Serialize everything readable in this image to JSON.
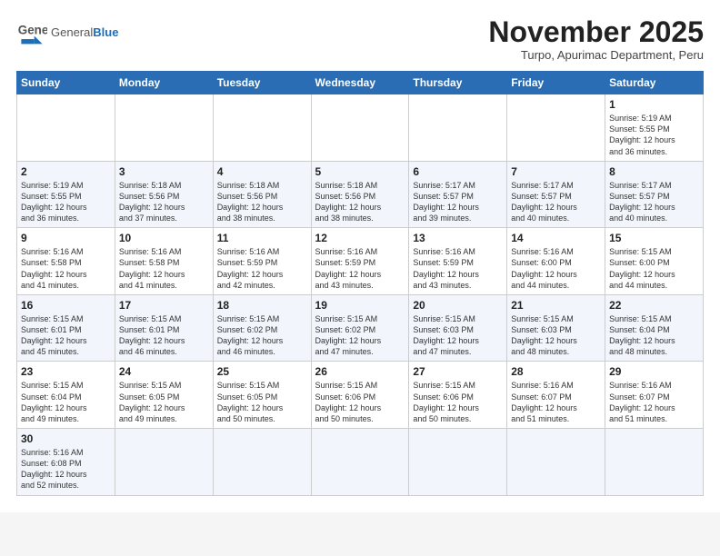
{
  "header": {
    "logo_general": "General",
    "logo_blue": "Blue",
    "month_title": "November 2025",
    "subtitle": "Turpo, Apurimac Department, Peru"
  },
  "weekdays": [
    "Sunday",
    "Monday",
    "Tuesday",
    "Wednesday",
    "Thursday",
    "Friday",
    "Saturday"
  ],
  "weeks": [
    [
      {
        "day": "",
        "info": ""
      },
      {
        "day": "",
        "info": ""
      },
      {
        "day": "",
        "info": ""
      },
      {
        "day": "",
        "info": ""
      },
      {
        "day": "",
        "info": ""
      },
      {
        "day": "",
        "info": ""
      },
      {
        "day": "1",
        "info": "Sunrise: 5:19 AM\nSunset: 5:55 PM\nDaylight: 12 hours\nand 36 minutes."
      }
    ],
    [
      {
        "day": "2",
        "info": "Sunrise: 5:19 AM\nSunset: 5:55 PM\nDaylight: 12 hours\nand 36 minutes."
      },
      {
        "day": "3",
        "info": "Sunrise: 5:18 AM\nSunset: 5:56 PM\nDaylight: 12 hours\nand 37 minutes."
      },
      {
        "day": "4",
        "info": "Sunrise: 5:18 AM\nSunset: 5:56 PM\nDaylight: 12 hours\nand 38 minutes."
      },
      {
        "day": "5",
        "info": "Sunrise: 5:18 AM\nSunset: 5:56 PM\nDaylight: 12 hours\nand 38 minutes."
      },
      {
        "day": "6",
        "info": "Sunrise: 5:17 AM\nSunset: 5:57 PM\nDaylight: 12 hours\nand 39 minutes."
      },
      {
        "day": "7",
        "info": "Sunrise: 5:17 AM\nSunset: 5:57 PM\nDaylight: 12 hours\nand 40 minutes."
      },
      {
        "day": "8",
        "info": "Sunrise: 5:17 AM\nSunset: 5:57 PM\nDaylight: 12 hours\nand 40 minutes."
      }
    ],
    [
      {
        "day": "9",
        "info": "Sunrise: 5:16 AM\nSunset: 5:58 PM\nDaylight: 12 hours\nand 41 minutes."
      },
      {
        "day": "10",
        "info": "Sunrise: 5:16 AM\nSunset: 5:58 PM\nDaylight: 12 hours\nand 41 minutes."
      },
      {
        "day": "11",
        "info": "Sunrise: 5:16 AM\nSunset: 5:59 PM\nDaylight: 12 hours\nand 42 minutes."
      },
      {
        "day": "12",
        "info": "Sunrise: 5:16 AM\nSunset: 5:59 PM\nDaylight: 12 hours\nand 43 minutes."
      },
      {
        "day": "13",
        "info": "Sunrise: 5:16 AM\nSunset: 5:59 PM\nDaylight: 12 hours\nand 43 minutes."
      },
      {
        "day": "14",
        "info": "Sunrise: 5:16 AM\nSunset: 6:00 PM\nDaylight: 12 hours\nand 44 minutes."
      },
      {
        "day": "15",
        "info": "Sunrise: 5:15 AM\nSunset: 6:00 PM\nDaylight: 12 hours\nand 44 minutes."
      }
    ],
    [
      {
        "day": "16",
        "info": "Sunrise: 5:15 AM\nSunset: 6:01 PM\nDaylight: 12 hours\nand 45 minutes."
      },
      {
        "day": "17",
        "info": "Sunrise: 5:15 AM\nSunset: 6:01 PM\nDaylight: 12 hours\nand 46 minutes."
      },
      {
        "day": "18",
        "info": "Sunrise: 5:15 AM\nSunset: 6:02 PM\nDaylight: 12 hours\nand 46 minutes."
      },
      {
        "day": "19",
        "info": "Sunrise: 5:15 AM\nSunset: 6:02 PM\nDaylight: 12 hours\nand 47 minutes."
      },
      {
        "day": "20",
        "info": "Sunrise: 5:15 AM\nSunset: 6:03 PM\nDaylight: 12 hours\nand 47 minutes."
      },
      {
        "day": "21",
        "info": "Sunrise: 5:15 AM\nSunset: 6:03 PM\nDaylight: 12 hours\nand 48 minutes."
      },
      {
        "day": "22",
        "info": "Sunrise: 5:15 AM\nSunset: 6:04 PM\nDaylight: 12 hours\nand 48 minutes."
      }
    ],
    [
      {
        "day": "23",
        "info": "Sunrise: 5:15 AM\nSunset: 6:04 PM\nDaylight: 12 hours\nand 49 minutes."
      },
      {
        "day": "24",
        "info": "Sunrise: 5:15 AM\nSunset: 6:05 PM\nDaylight: 12 hours\nand 49 minutes."
      },
      {
        "day": "25",
        "info": "Sunrise: 5:15 AM\nSunset: 6:05 PM\nDaylight: 12 hours\nand 50 minutes."
      },
      {
        "day": "26",
        "info": "Sunrise: 5:15 AM\nSunset: 6:06 PM\nDaylight: 12 hours\nand 50 minutes."
      },
      {
        "day": "27",
        "info": "Sunrise: 5:15 AM\nSunset: 6:06 PM\nDaylight: 12 hours\nand 50 minutes."
      },
      {
        "day": "28",
        "info": "Sunrise: 5:16 AM\nSunset: 6:07 PM\nDaylight: 12 hours\nand 51 minutes."
      },
      {
        "day": "29",
        "info": "Sunrise: 5:16 AM\nSunset: 6:07 PM\nDaylight: 12 hours\nand 51 minutes."
      }
    ],
    [
      {
        "day": "30",
        "info": "Sunrise: 5:16 AM\nSunset: 6:08 PM\nDaylight: 12 hours\nand 52 minutes."
      },
      {
        "day": "",
        "info": ""
      },
      {
        "day": "",
        "info": ""
      },
      {
        "day": "",
        "info": ""
      },
      {
        "day": "",
        "info": ""
      },
      {
        "day": "",
        "info": ""
      },
      {
        "day": "",
        "info": ""
      }
    ]
  ]
}
